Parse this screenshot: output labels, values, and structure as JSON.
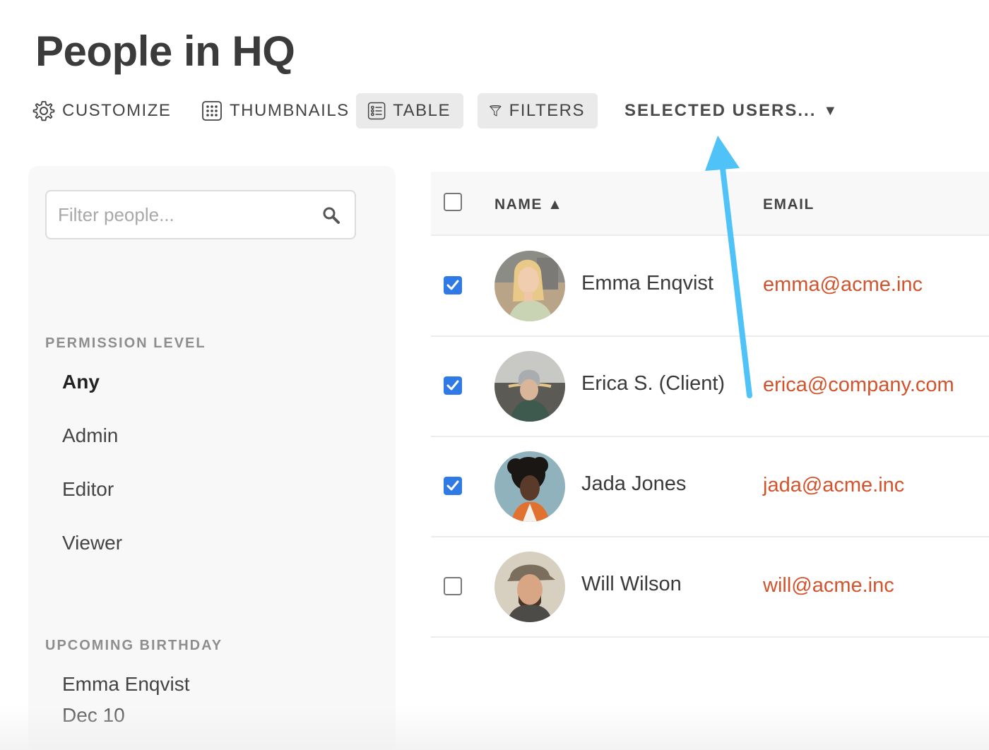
{
  "page": {
    "title": "People in HQ"
  },
  "toolbar": {
    "customize": "CUSTOMIZE",
    "thumbnails": "THUMBNAILS",
    "table": "TABLE",
    "filters": "FILTERS",
    "selected_users": "SELECTED USERS...",
    "selected_caret": "▼"
  },
  "sidebar": {
    "search": {
      "placeholder": "Filter people...",
      "value": ""
    },
    "permission": {
      "label": "PERMISSION LEVEL",
      "items": [
        {
          "label": "Any",
          "selected": true
        },
        {
          "label": "Admin",
          "selected": false
        },
        {
          "label": "Editor",
          "selected": false
        },
        {
          "label": "Viewer",
          "selected": false
        }
      ]
    },
    "birthday": {
      "label": "UPCOMING BIRTHDAY",
      "name": "Emma Enqvist",
      "date": "Dec 10"
    }
  },
  "table": {
    "columns": {
      "name": "NAME ▲",
      "email": "EMAIL"
    },
    "rows": [
      {
        "name": "Emma Enqvist",
        "email": "emma@acme.inc",
        "checked": true
      },
      {
        "name": "Erica S. (Client)",
        "email": "erica@company.com",
        "checked": true
      },
      {
        "name": "Jada Jones",
        "email": "jada@acme.inc",
        "checked": true
      },
      {
        "name": "Will Wilson",
        "email": "will@acme.inc",
        "checked": false
      }
    ]
  },
  "colors": {
    "accent": "#2f7ae5",
    "email": "#d3532c",
    "annotation_arrow": "#4fc3f7"
  },
  "icons": [
    "gear-icon",
    "grid-icon",
    "list-icon",
    "funnel-icon",
    "search-icon",
    "check-icon",
    "arrow-annotation"
  ]
}
